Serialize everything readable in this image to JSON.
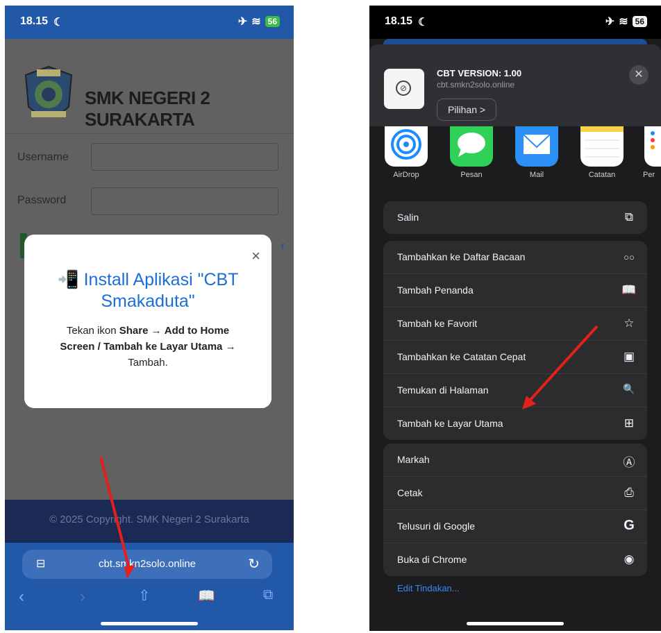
{
  "left_phone": {
    "status": {
      "time": "18.15",
      "moon_icon": "moon-icon",
      "airplane_icon": "airplane-icon",
      "wifi_icon": "wifi-icon",
      "battery": "56"
    },
    "school_name": "SMK NEGERI 2 SURAKARTA",
    "username_label": "Username",
    "password_label": "Password",
    "modal": {
      "close": "×",
      "title": "📲 Install Aplikasi \"CBT Smakaduta\"",
      "desc_1": "Tekan ikon ",
      "desc_share": "Share",
      "desc_2": " → ",
      "desc_add": "Add to Home Screen / Tambah ke Layar Utama",
      "desc_3": " → Tambah."
    },
    "partial_link": "r",
    "footer": "© 2025 Copyright. SMK Negeri 2 Surakarta",
    "url": "cbt.smkn2solo.online"
  },
  "right_phone": {
    "status": {
      "time": "18.15",
      "battery": "56"
    },
    "site_title": "CBT VERSION: 1.00",
    "site_url": "cbt.smkn2solo.online",
    "options_button": "Pilihan >",
    "close": "✕",
    "apps": [
      {
        "label": "AirDrop",
        "icon": "airdrop-icon",
        "color": "#1a8cff"
      },
      {
        "label": "Pesan",
        "icon": "messages-icon",
        "color": "#30d158"
      },
      {
        "label": "Mail",
        "icon": "mail-icon",
        "color": "#2b8ff5"
      },
      {
        "label": "Catatan",
        "icon": "notes-icon",
        "color": "#fefefe"
      },
      {
        "label": "Per",
        "icon": "reminders-icon",
        "color": "#ffffff"
      }
    ],
    "group1": [
      {
        "label": "Salin",
        "icon": "⧉"
      }
    ],
    "group2": [
      {
        "label": "Tambahkan ke Daftar Bacaan",
        "icon": "○○"
      },
      {
        "label": "Tambah Penanda",
        "icon": "📖"
      },
      {
        "label": "Tambah ke Favorit",
        "icon": "☆"
      },
      {
        "label": "Tambahkan ke Catatan Cepat",
        "icon": "▣"
      },
      {
        "label": "Temukan di Halaman",
        "icon": "🔍"
      },
      {
        "label": "Tambah ke Layar Utama",
        "icon": "⊞"
      }
    ],
    "group3": [
      {
        "label": "Markah",
        "icon": "Ⓐ"
      },
      {
        "label": "Cetak",
        "icon": "⎙"
      },
      {
        "label": "Telusuri di Google",
        "icon": "G"
      },
      {
        "label": "Buka di Chrome",
        "icon": "◉"
      }
    ],
    "edit_actions": "Edit Tindakan..."
  },
  "colors": {
    "annotation_arrow": "#e3201b",
    "link_blue": "#3d87f5",
    "safari_bar": "#2158a8"
  }
}
